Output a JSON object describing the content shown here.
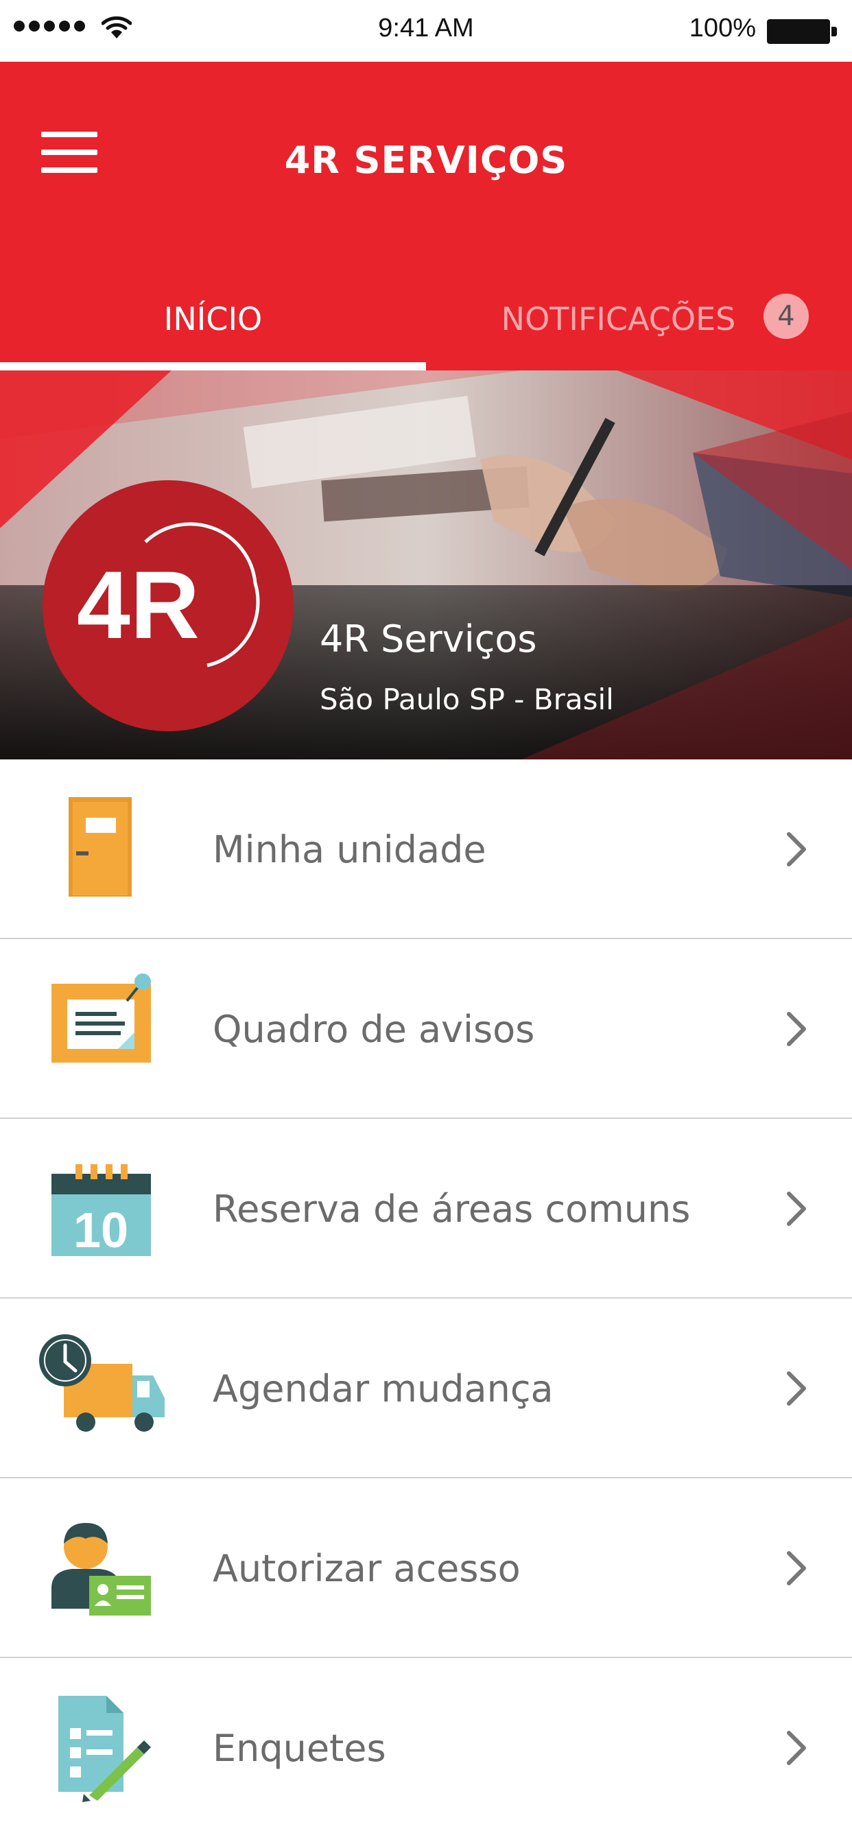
{
  "status_bar": {
    "time": "9:41 AM",
    "battery": "100%"
  },
  "header": {
    "title": "4R SERVIÇOS",
    "menu_icon": "hamburger-menu-icon",
    "background_color": "#e8232c"
  },
  "tabs": [
    {
      "label": "INÍCIO",
      "active": true
    },
    {
      "label": "NOTIFICAÇÕES",
      "active": false,
      "badge": "4"
    }
  ],
  "company": {
    "logo_text": "4R",
    "name": "4R Serviços",
    "location": "São Paulo SP - Brasil"
  },
  "menu_items": [
    {
      "label": "Minha unidade",
      "icon": "door-icon"
    },
    {
      "label": "Quadro de avisos",
      "icon": "notice-board-icon"
    },
    {
      "label": "Reserva de áreas comuns",
      "icon": "calendar-icon",
      "icon_text": "10"
    },
    {
      "label": "Agendar mudança",
      "icon": "moving-truck-icon"
    },
    {
      "label": "Autorizar acesso",
      "icon": "visitor-access-icon"
    },
    {
      "label": "Enquetes",
      "icon": "survey-icon"
    }
  ]
}
